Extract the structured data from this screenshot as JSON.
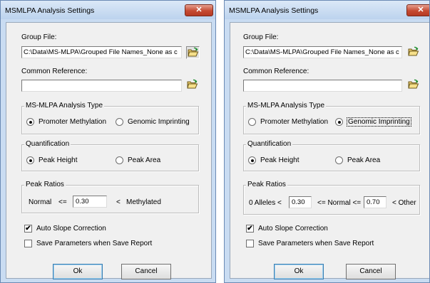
{
  "dialogs": [
    {
      "title": "MSMLPA Analysis Settings",
      "close_glyph": "✕",
      "group_file_label": "Group File:",
      "group_file_value": "C:\\Data\\MS-MLPA\\Grouped File Names_None as c",
      "common_reference_label": "Common Reference:",
      "common_reference_value": "",
      "analysis_type_legend": "MS-MLPA Analysis Type",
      "analysis_type_options": [
        "Promoter Methylation",
        "Genomic Imprinting"
      ],
      "analysis_type_selected": "Promoter Methylation",
      "quantification_legend": "Quantification",
      "quantification_options": [
        "Peak Height",
        "Peak Area"
      ],
      "quantification_selected": "Peak Height",
      "peak_ratios_legend": "Peak Ratios",
      "peak_ratios": {
        "normal_label": "Normal",
        "le_label": "<=",
        "value": "0.30",
        "lt_label": "<",
        "methylated_label": "Methylated"
      },
      "auto_slope_label": "Auto Slope Correction",
      "auto_slope_checked": true,
      "save_params_label": "Save Parameters when  Save Report",
      "save_params_checked": false,
      "ok_label": "Ok",
      "cancel_label": "Cancel"
    },
    {
      "title": "MSMLPA Analysis Settings",
      "close_glyph": "✕",
      "group_file_label": "Group File:",
      "group_file_value": "C:\\Data\\MS-MLPA\\Grouped File Names_None as c",
      "common_reference_label": "Common Reference:",
      "common_reference_value": "",
      "analysis_type_legend": "MS-MLPA Analysis Type",
      "analysis_type_options": [
        "Promoter Methylation",
        "Genomic Imprinting"
      ],
      "analysis_type_selected": "Genomic Imprinting",
      "quantification_legend": "Quantification",
      "quantification_options": [
        "Peak Height",
        "Peak Area"
      ],
      "quantification_selected": "Peak Height",
      "peak_ratios_legend": "Peak Ratios",
      "peak_ratios": {
        "zero_alleles_label": "0 Alleles <",
        "value_1": "0.30",
        "normal_label": "<= Normal <=",
        "value_2": "0.70",
        "other_label": "< Other"
      },
      "auto_slope_label": "Auto Slope Correction",
      "auto_slope_checked": true,
      "save_params_label": "Save Parameters when  Save Report",
      "save_params_checked": false,
      "ok_label": "Ok",
      "cancel_label": "Cancel"
    }
  ],
  "icons": {
    "folder": "folder-open-icon",
    "check": "✔"
  }
}
